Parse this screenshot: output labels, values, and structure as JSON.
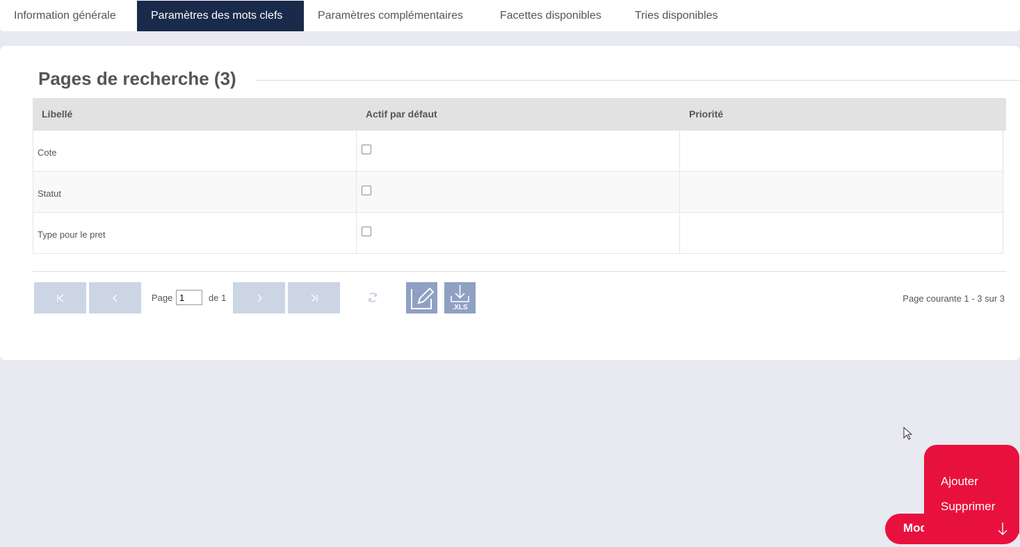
{
  "tabs": [
    {
      "label": "Information générale"
    },
    {
      "label": "Paramètres des mots clefs",
      "active": true
    },
    {
      "label": "Paramètres complémentaires"
    },
    {
      "label": "Facettes disponibles"
    },
    {
      "label": "Tries disponibles"
    }
  ],
  "section": {
    "title": "Pages de recherche (3)"
  },
  "table": {
    "headers": [
      "Libellé",
      "Actif par défaut",
      "Priorité"
    ],
    "rows": [
      {
        "label": "Cote",
        "active": false,
        "priority": ""
      },
      {
        "label": "Statut",
        "active": false,
        "priority": ""
      },
      {
        "label": "Type pour le pret",
        "active": false,
        "priority": ""
      }
    ]
  },
  "pager": {
    "page_label": "Page",
    "page_value": "1",
    "of_label": "de 1",
    "status": "Page courante 1 - 3 sur 3",
    "xls_label": ".XLS"
  },
  "fab": {
    "label": "Modifier",
    "menu": [
      "Ajouter",
      "Supprimer"
    ]
  },
  "colors": {
    "active_tab": "#1a2a4a",
    "fab": "#e8113e",
    "pager_button": "#ccd5e4",
    "icon_button": "#8fa0c3"
  }
}
